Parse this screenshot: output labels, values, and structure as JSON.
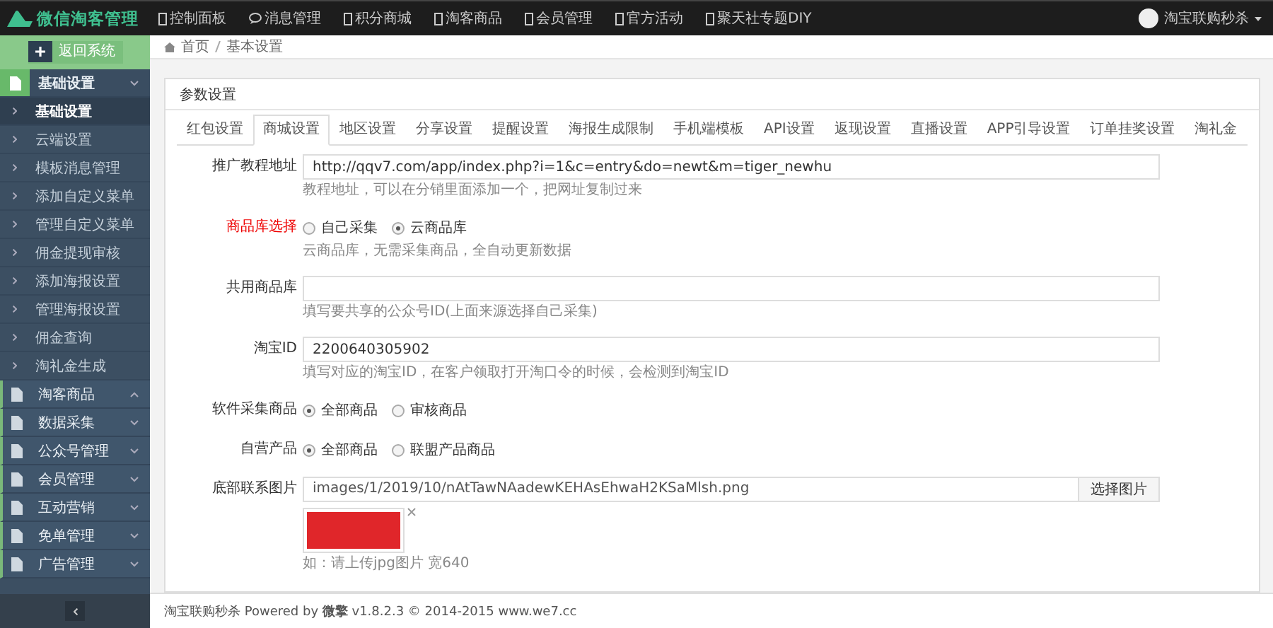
{
  "topbar": {
    "logo": "微信淘客管理",
    "nav": [
      {
        "label": "控制面板",
        "kind": "page"
      },
      {
        "label": "消息管理",
        "kind": "chat"
      },
      {
        "label": "积分商城",
        "kind": "page"
      },
      {
        "label": "淘客商品",
        "kind": "page"
      },
      {
        "label": "会员管理",
        "kind": "page"
      },
      {
        "label": "官方活动",
        "kind": "page"
      },
      {
        "label": "聚天社专题DIY",
        "kind": "page"
      }
    ],
    "user": "淘宝联购秒杀"
  },
  "sidebar": {
    "return_button": "返回系统",
    "groups": [
      {
        "label": "基础设置",
        "selected": true,
        "expanded": false,
        "children": [
          {
            "label": "基础设置",
            "selected": true
          },
          {
            "label": "云端设置",
            "selected": false
          },
          {
            "label": "模板消息管理",
            "selected": false
          },
          {
            "label": "添加自定义菜单",
            "selected": false
          },
          {
            "label": "管理自定义菜单",
            "selected": false
          },
          {
            "label": "佣金提现审核",
            "selected": false
          },
          {
            "label": "添加海报设置",
            "selected": false
          },
          {
            "label": "管理海报设置",
            "selected": false
          },
          {
            "label": "佣金查询",
            "selected": false
          },
          {
            "label": "淘礼金生成",
            "selected": false
          }
        ]
      },
      {
        "label": "淘客商品",
        "selected": false,
        "expanded": true
      },
      {
        "label": "数据采集",
        "selected": false,
        "expanded": false
      },
      {
        "label": "公众号管理",
        "selected": false,
        "expanded": false
      },
      {
        "label": "会员管理",
        "selected": false,
        "expanded": false
      },
      {
        "label": "互动营销",
        "selected": false,
        "expanded": false
      },
      {
        "label": "免单管理",
        "selected": false,
        "expanded": false
      },
      {
        "label": "广告管理",
        "selected": false,
        "expanded": false
      }
    ]
  },
  "breadcrumb": [
    "首页",
    "基本设置"
  ],
  "panel": {
    "title": "参数设置",
    "tabs": [
      {
        "label": "红包设置",
        "selected": false
      },
      {
        "label": "商城设置",
        "selected": true
      },
      {
        "label": "地区设置",
        "selected": false
      },
      {
        "label": "分享设置",
        "selected": false
      },
      {
        "label": "提醒设置",
        "selected": false
      },
      {
        "label": "海报生成限制",
        "selected": false
      },
      {
        "label": "手机端模板",
        "selected": false
      },
      {
        "label": "API设置",
        "selected": false
      },
      {
        "label": "返现设置",
        "selected": false
      },
      {
        "label": "直播设置",
        "selected": false
      },
      {
        "label": "APP引导设置",
        "selected": false
      },
      {
        "label": "订单挂奖设置",
        "selected": false
      },
      {
        "label": "淘礼金",
        "selected": false
      }
    ],
    "fields": [
      {
        "kind": "text",
        "label": "推广教程地址",
        "highlighted": false,
        "value": "http://qqv7.com/app/index.php?i=1&c=entry&do=newt&m=tiger_newhu",
        "help": "教程地址，可以在分销里面添加一个，把网址复制过来"
      },
      {
        "kind": "radio",
        "label": "商品库选择",
        "highlighted": true,
        "options": [
          {
            "label": "自己采集",
            "selected": false
          },
          {
            "label": "云商品库",
            "selected": true
          }
        ],
        "help": "云商品库，无需采集商品，全自动更新数据"
      },
      {
        "kind": "text",
        "label": "共用商品库",
        "highlighted": false,
        "help": "填写要共享的公众号ID(上面来源选择自己采集)"
      },
      {
        "kind": "text",
        "label": "淘宝ID",
        "highlighted": false,
        "value": "2200640305902",
        "help": "填写对应的淘宝ID，在客户领取打开淘口令的时候，会检测到淘宝ID"
      },
      {
        "kind": "radio",
        "label": "软件采集商品",
        "highlighted": false,
        "options": [
          {
            "label": "全部商品",
            "selected": true
          },
          {
            "label": "审核商品",
            "selected": false
          }
        ]
      },
      {
        "kind": "radio",
        "label": "自营产品",
        "highlighted": false,
        "options": [
          {
            "label": "全部商品",
            "selected": true
          },
          {
            "label": "联盟产品商品",
            "selected": false
          }
        ]
      },
      {
        "kind": "image",
        "label": "底部联系图片",
        "highlighted": false,
        "value": "images/1/2019/10/nAtTawNAadewKEHAsEhwaH2KSaMlsh.png",
        "button": "选择图片",
        "help": "如：请上传jpg图片 宽640"
      }
    ]
  },
  "footer": "淘宝联购秒杀 Powered by **微擎** v1.8.2.3 © 2014-2015 www.we7.cc"
}
